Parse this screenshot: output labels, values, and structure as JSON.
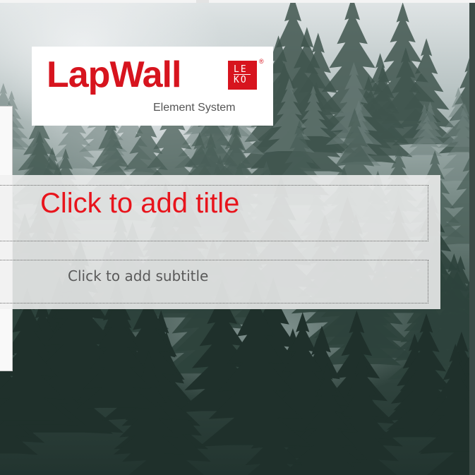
{
  "slide": {
    "logo": {
      "brand": "LapWall",
      "badge_top": "LE",
      "badge_bottom": "KO",
      "registered": "®",
      "tagline": "Element System"
    },
    "title_placeholder": "Click to add title",
    "subtitle_placeholder": "Click to add subtitle"
  },
  "colors": {
    "brand_red": "#d7141e",
    "title_red": "#e8141c",
    "subtitle_gray": "#5a5a5a"
  },
  "background": {
    "image_icon": "misty-forest-photo"
  }
}
